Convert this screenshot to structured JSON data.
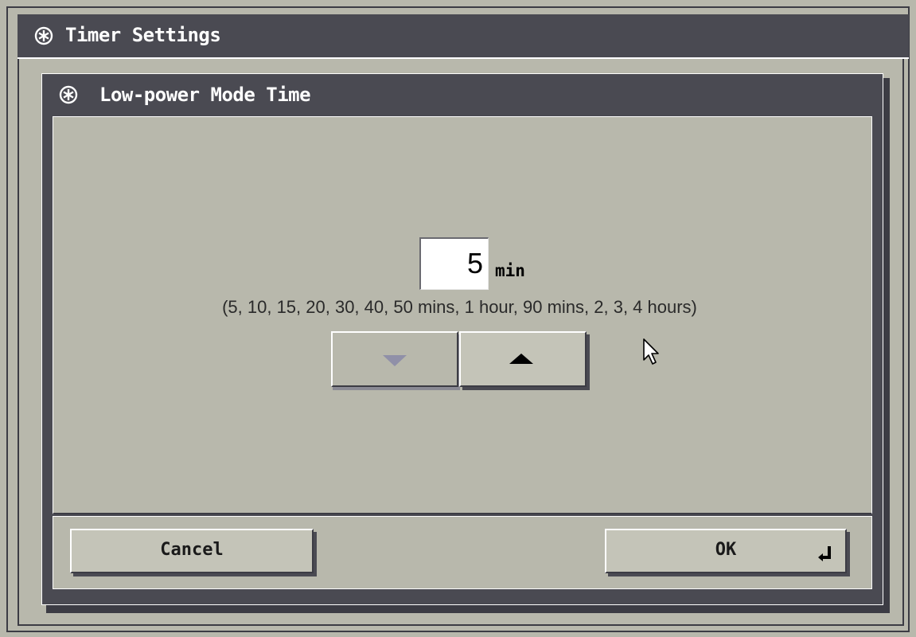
{
  "window": {
    "title": "Timer Settings",
    "icon": "asterisk-circle-icon"
  },
  "dialog": {
    "title": "Low-power Mode Time",
    "icon": "asterisk-circle-icon"
  },
  "setting": {
    "value": "5",
    "unit": "min",
    "range_hint": "(5, 10, 15, 20, 30, 40, 50 mins, 1 hour, 90 mins, 2, 3, 4 hours)"
  },
  "controls": {
    "down_icon": "triangle-down-icon",
    "up_icon": "triangle-up-icon"
  },
  "footer": {
    "cancel_label": "Cancel",
    "ok_label": "OK",
    "ok_icon": "enter-return-icon"
  },
  "colors": {
    "panel": "#b8b8ac",
    "titlebar": "#4a4a52",
    "title_text": "#ffffff"
  }
}
